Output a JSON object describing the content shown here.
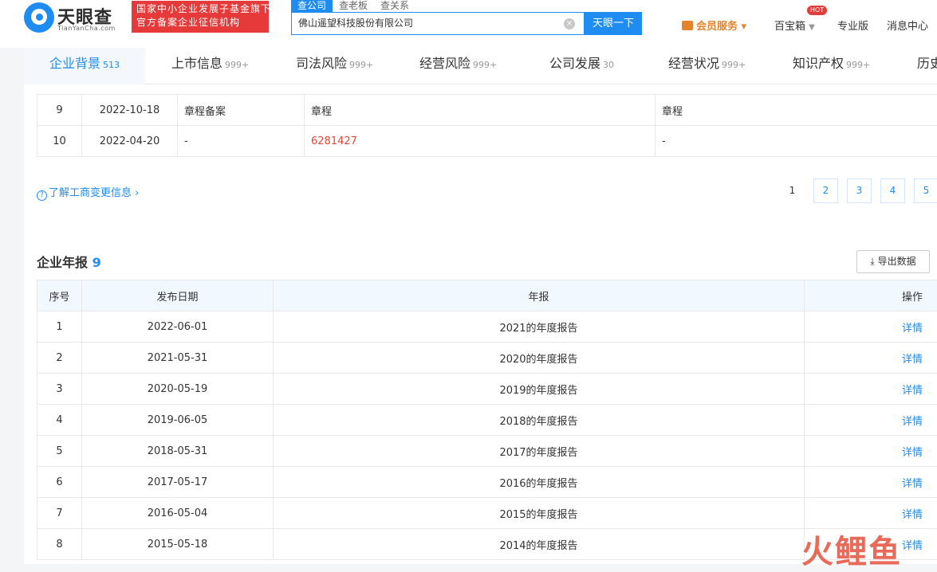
{
  "logo": {
    "name": "天眼查",
    "sub": "TianYanCha.com"
  },
  "badge": {
    "line1": "国家中小企业发展子基金旗下",
    "line2": "官方备案企业征信机构"
  },
  "search": {
    "tabs": [
      "查公司",
      "查老板",
      "查关系"
    ],
    "value": "佛山遥望科技股份有限公司",
    "button": "天眼一下",
    "clear": "×"
  },
  "nav": {
    "member": "会员服务 ▾",
    "baibao": "百宝箱",
    "hot": "HOT",
    "pro": "专业版",
    "msg": "消息中心"
  },
  "tabs": [
    {
      "label": "企业背景",
      "count": "513"
    },
    {
      "label": "上市信息",
      "count": "999+"
    },
    {
      "label": "司法风险",
      "count": "999+"
    },
    {
      "label": "经营风险",
      "count": "999+"
    },
    {
      "label": "公司发展",
      "count": "30"
    },
    {
      "label": "经营状况",
      "count": "999+"
    },
    {
      "label": "知识产权",
      "count": "999+"
    },
    {
      "label": "历史",
      "count": ""
    }
  ],
  "change_rows": [
    {
      "no": "9",
      "date": "2022-10-18",
      "item": "章程备案",
      "before": "章程",
      "after": "章程"
    },
    {
      "no": "10",
      "date": "2022-04-20",
      "item": "-",
      "before": "6281427",
      "after": "-"
    }
  ],
  "help": {
    "icon": "?",
    "text": "了解工商变更信息 ›"
  },
  "pager": [
    "1",
    "2",
    "3",
    "4",
    "5"
  ],
  "annual": {
    "title": "企业年报",
    "count": "9",
    "export": "导出数据",
    "headers": [
      "序号",
      "发布日期",
      "年报",
      "操作"
    ],
    "rows": [
      {
        "no": "1",
        "date": "2022-06-01",
        "report": "2021的年度报告",
        "op": "详情"
      },
      {
        "no": "2",
        "date": "2021-05-31",
        "report": "2020的年度报告",
        "op": "详情"
      },
      {
        "no": "3",
        "date": "2020-05-19",
        "report": "2019的年度报告",
        "op": "详情"
      },
      {
        "no": "4",
        "date": "2019-06-05",
        "report": "2018的年度报告",
        "op": "详情"
      },
      {
        "no": "5",
        "date": "2018-05-31",
        "report": "2017的年度报告",
        "op": "详情"
      },
      {
        "no": "6",
        "date": "2017-05-17",
        "report": "2016的年度报告",
        "op": "详情"
      },
      {
        "no": "7",
        "date": "2016-05-04",
        "report": "2015的年度报告",
        "op": "详情"
      },
      {
        "no": "8",
        "date": "2015-05-18",
        "report": "2014的年度报告",
        "op": "详情"
      }
    ]
  },
  "watermark": "火鲤鱼"
}
